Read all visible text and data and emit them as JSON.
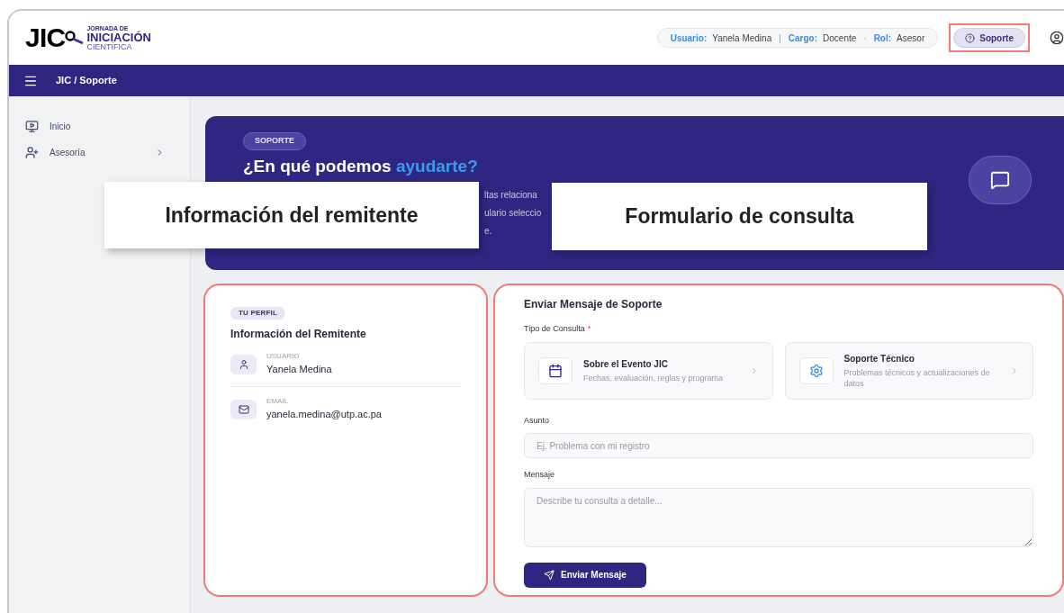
{
  "logo": {
    "mark": "JIC",
    "line_1": "JORNADA DE",
    "line_2": "INICIACIÓN",
    "line_3": "CIENTÍFICA"
  },
  "user_info": [
    {
      "label": "Usuario:",
      "value": "Yanela Medina"
    },
    {
      "separator": "|",
      "label": "Cargo:",
      "value": "Docente"
    },
    {
      "separator": "·",
      "label": "Rol:",
      "value": "Asesor"
    }
  ],
  "support_button": {
    "label": "Soporte",
    "highlighted": true
  },
  "breadcrumb": "JIC / Soporte",
  "sidebar": {
    "items": [
      {
        "label": "Inicio",
        "kind": "link",
        "selected": false
      },
      {
        "label": "Asesoría",
        "kind": "group",
        "selected": false
      }
    ]
  },
  "hero": {
    "badge": "SOPORTE",
    "title": "¿En qué podemos **ayudarte?**",
    "description_fragments": [
      "ltas relaciona",
      "ulario seleccio",
      "e."
    ]
  },
  "profile_card": {
    "badge": "TU PERFIL",
    "title": "Información del Remitente",
    "highlighted": true,
    "fields": [
      {
        "kind": "user",
        "label": "USUARIO",
        "value": "Yanela Medina"
      },
      {
        "kind": "email",
        "label": "EMAIL",
        "value": "yanela.medina@utp.ac.pa"
      }
    ]
  },
  "form_card": {
    "title": "Enviar Mensaje de Soporte",
    "highlighted": true,
    "type_label": "Tipo de Consulta",
    "required_mark": "*",
    "options": [
      {
        "kind": "event",
        "title": "Sobre el Evento JIC",
        "description": "Fechas, evaluación, reglas y programa",
        "selected": false
      },
      {
        "kind": "tech",
        "title": "Soporte Técnico",
        "description": "Problemas técnicos y actualizaciones de datos",
        "selected": false
      }
    ],
    "subject": {
      "label": "Asunto",
      "placeholder": "Ej. Problema con mi registro"
    },
    "message": {
      "label": "Mensaje",
      "placeholder": "Describe tu consulta a detalle..."
    },
    "submit": "Enviar Mensaje"
  },
  "callouts": [
    "Información del remitente",
    "Formulario de consulta"
  ]
}
